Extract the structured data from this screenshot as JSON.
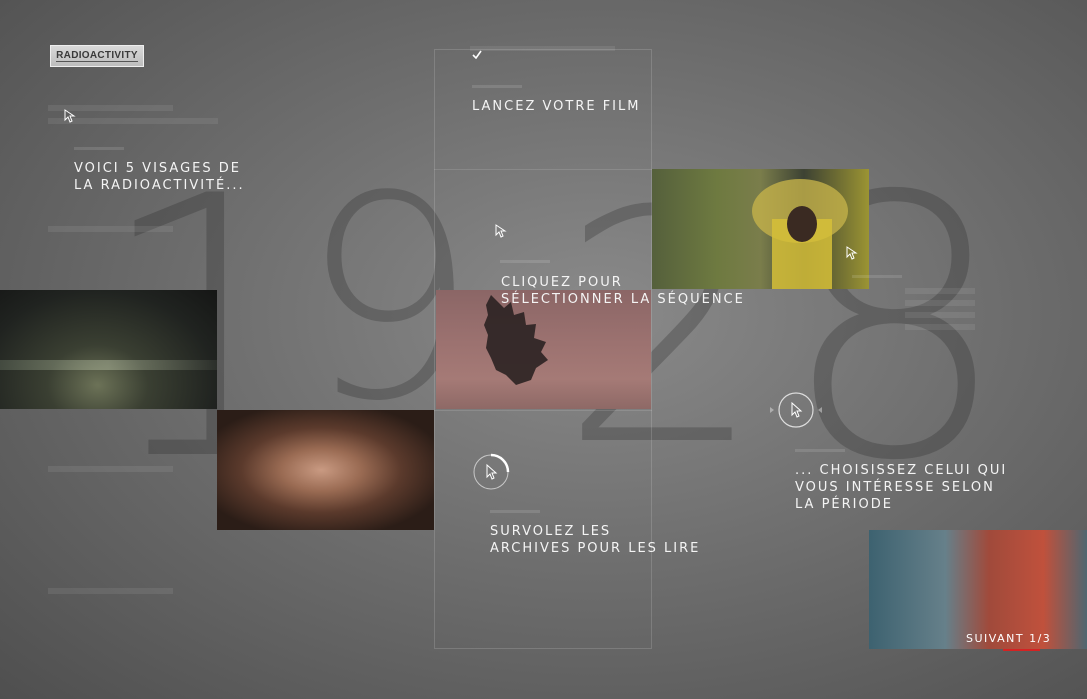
{
  "logo": {
    "text": "RADIOACTIVITY"
  },
  "background": {
    "digits": [
      "1",
      "9",
      "2",
      "8"
    ]
  },
  "steps": {
    "intro": "VOICI 5 VISAGES DE\nLA RADIOACTIVITÉ...",
    "launch": "LANCEZ VOTRE FILM",
    "select": "CLIQUEZ POUR\nSÉLECTIONNER LA SÉQUENCE",
    "hover": "SURVOLEZ LES\nARCHIVES POUR LES LIRE",
    "choose": "... CHOISISSEZ CELUI QUI\nVOUS INTÉRESSE SELON\nLA PÉRIODE"
  },
  "icons": {
    "check": "check-icon",
    "cursor": "cursor-icon",
    "loading": "loading-circle-icon",
    "slider": "slider-circle-icon"
  },
  "navigation": {
    "next_label": "SUIVANT 1/3"
  },
  "colors": {
    "accent": "#d42323",
    "background": "#6f6f6f",
    "text": "#f4f4f4"
  }
}
